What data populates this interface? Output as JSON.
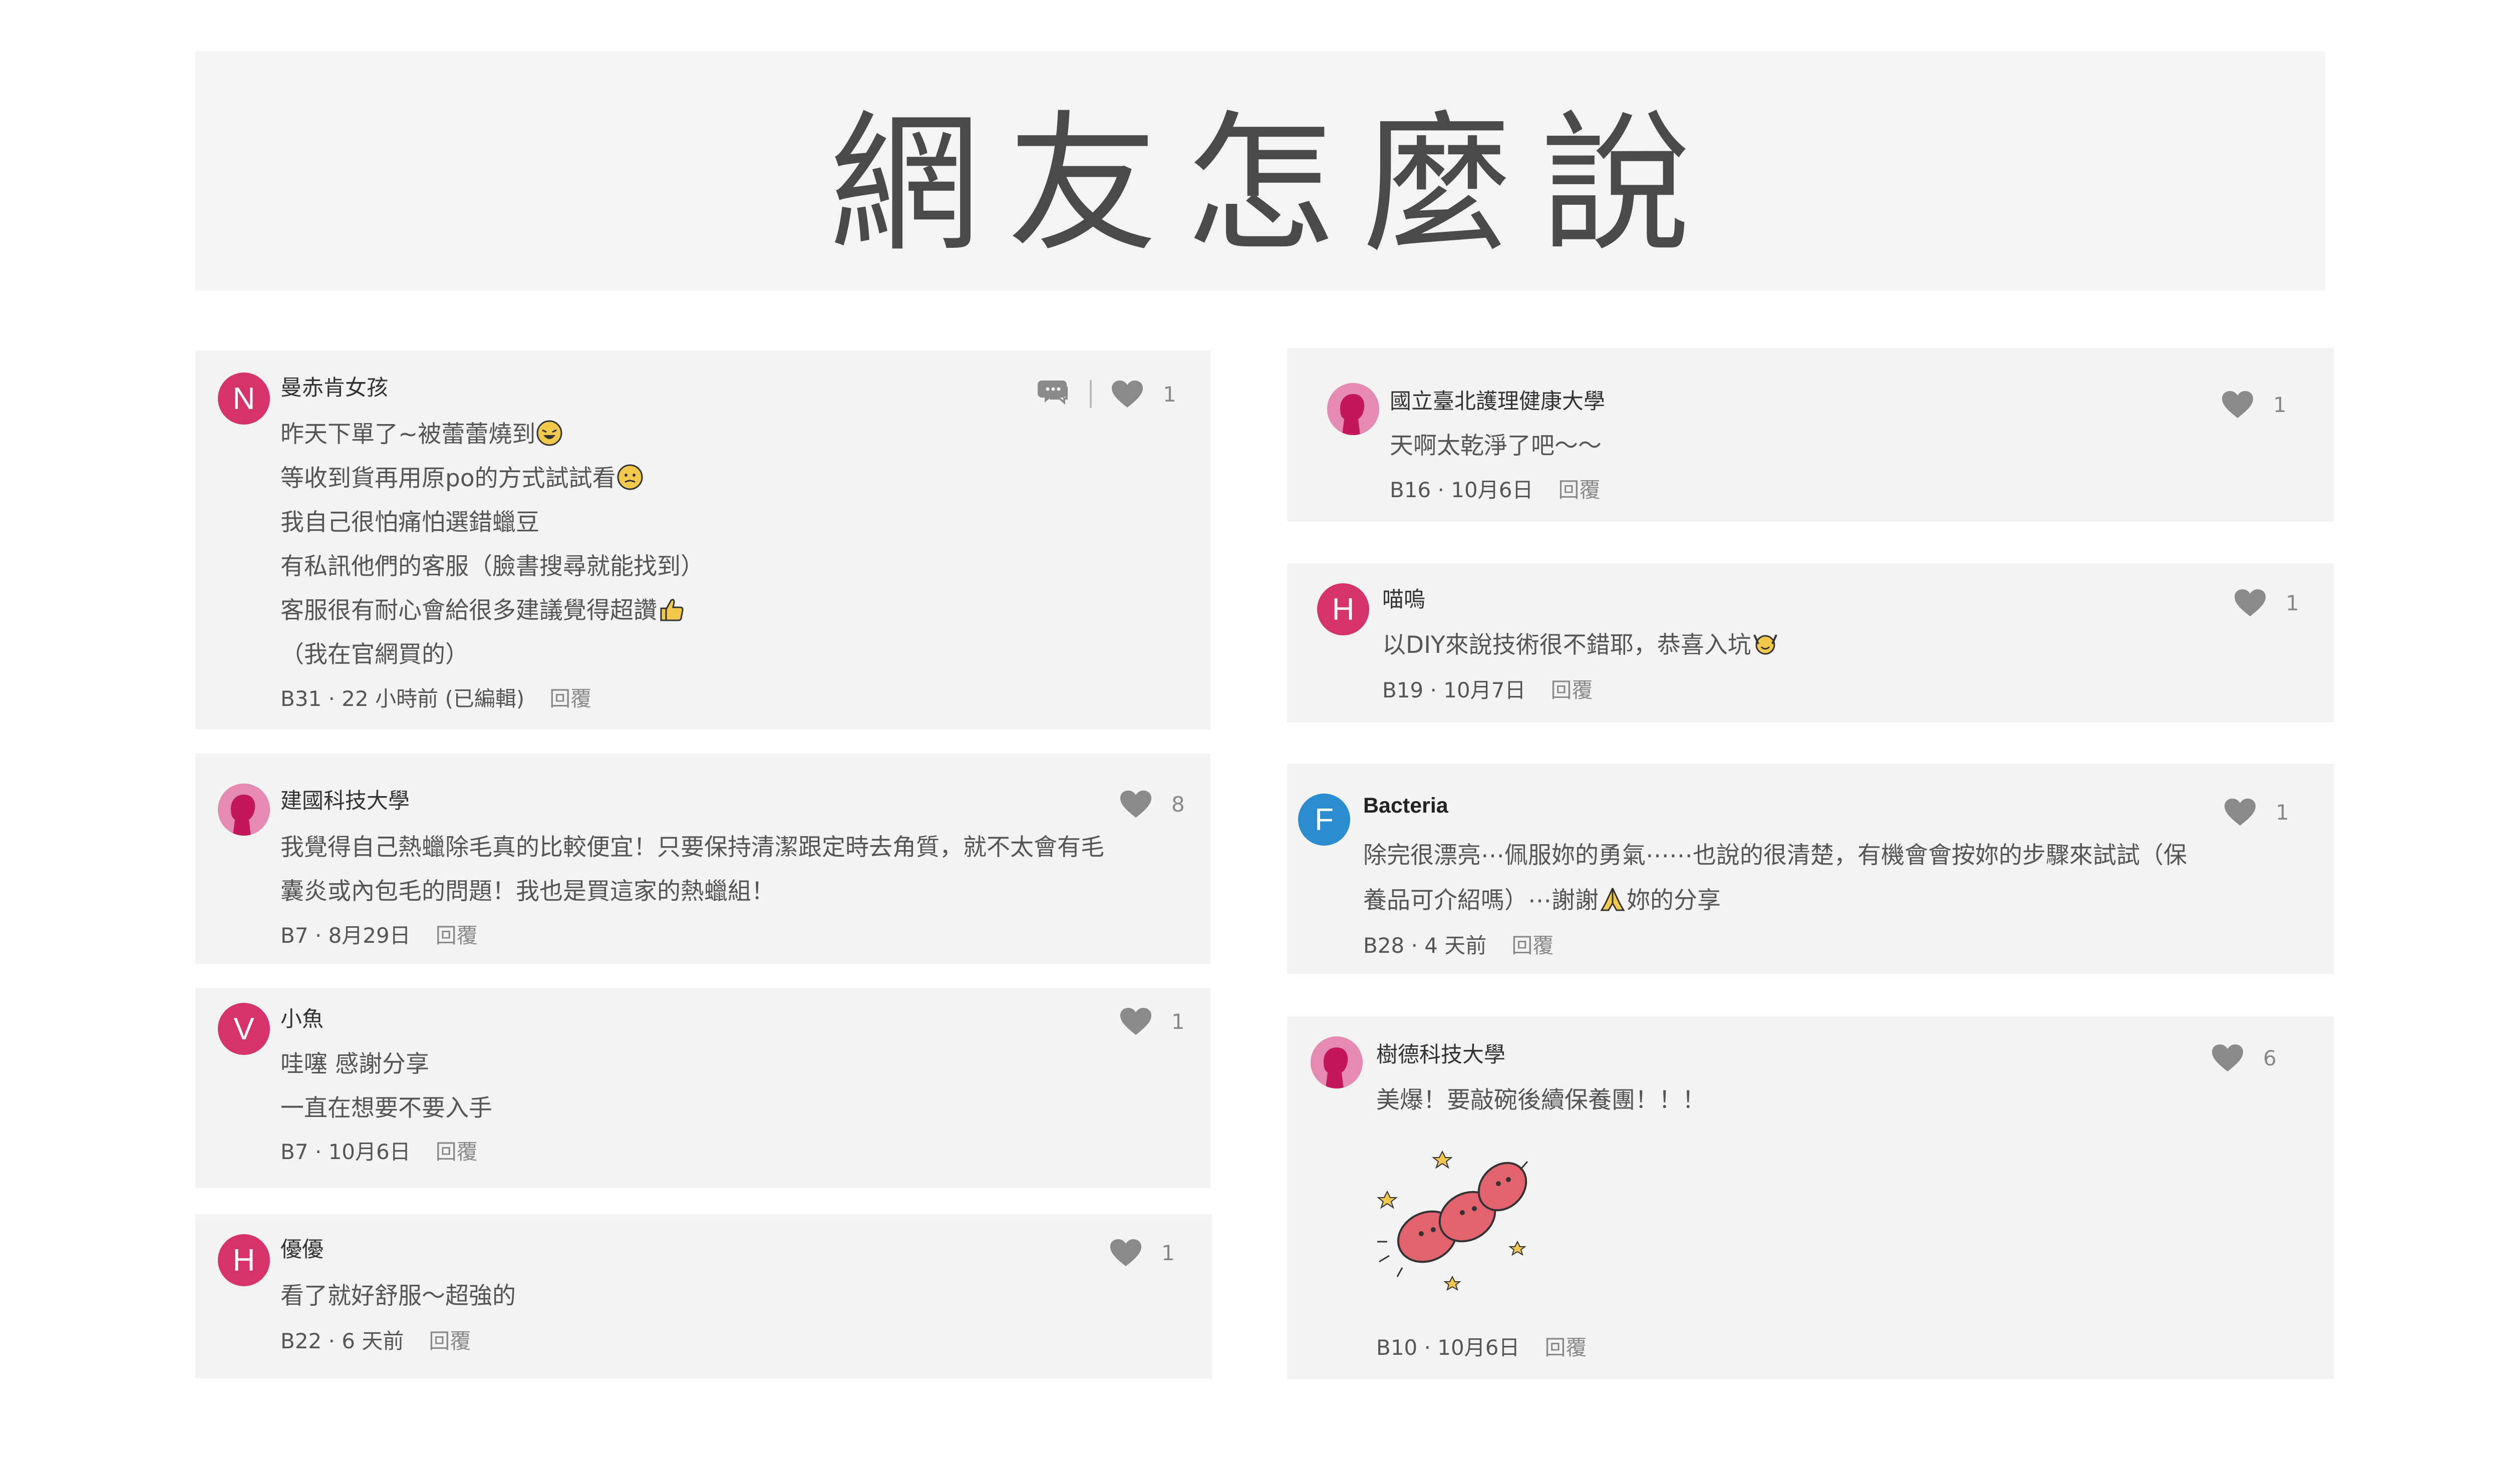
{
  "page_title": "網友怎麼說",
  "left_comments": [
    {
      "user": "曼赤肯女孩",
      "avatar_letter": "N",
      "lines": [
        "昨天下單了~被蕾蕾燒到",
        "等收到貨再用原po的方式試試看",
        "我自己很怕痛怕選錯蠟豆",
        "有私訊他們的客服（臉書搜尋就能找到）",
        "客服很有耐心會給很多建議覺得超讚",
        "（我在官網買的）"
      ],
      "meta": "B31 · 22 小時前 (已編輯)",
      "reply": "回覆",
      "likes": "1"
    },
    {
      "user": "建國科技大學",
      "lines": [
        "我覺得自己熱蠟除毛真的比較便宜！只要保持清潔跟定時去角質，就不太會有毛",
        "囊炎或內包毛的問題！我也是買這家的熱蠟組！"
      ],
      "meta": "B7 · 8月29日",
      "reply": "回覆",
      "likes": "8"
    },
    {
      "user": "小魚",
      "avatar_letter": "V",
      "lines": [
        "哇噻 感謝分享",
        "一直在想要不要入手"
      ],
      "meta": "B7 · 10月6日",
      "reply": "回覆",
      "likes": "1"
    },
    {
      "user": "優優",
      "avatar_letter": "H",
      "lines": [
        "看了就好舒服～超強的"
      ],
      "meta": "B22 · 6 天前",
      "reply": "回覆",
      "likes": "1"
    }
  ],
  "right_comments": [
    {
      "user": "國立臺北護理健康大學",
      "lines": [
        "天啊太乾淨了吧～～"
      ],
      "meta": "B16 · 10月6日",
      "reply": "回覆",
      "likes": "1"
    },
    {
      "user": "喵嗚",
      "avatar_letter": "H",
      "lines": [
        "以DIY來說技術很不錯耶，恭喜入坑"
      ],
      "meta": "B19 · 10月7日",
      "reply": "回覆",
      "likes": "1"
    },
    {
      "user": "Bacteria",
      "avatar_letter": "F",
      "lines": [
        "除完很漂亮⋯佩服妳的勇氣⋯⋯也說的很清楚，有機會會按妳的步驟來試試（保",
        "養品可介紹嗎）⋯謝謝",
        "妳的分享"
      ],
      "meta": "B28 · 4 天前",
      "reply": "回覆",
      "likes": "1"
    },
    {
      "user": "樹德科技大學",
      "lines": [
        "美爆！要敲碗後續保養團！！！"
      ],
      "meta": "B10 · 10月6日",
      "reply": "回覆",
      "likes": "6"
    }
  ],
  "icons": {
    "like": "heart-icon",
    "comment": "comment-bubble-icon",
    "school_avatar": "school-avatar-icon"
  },
  "colors": {
    "avatar_pink": "#d6336c",
    "avatar_blue": "#2b8ccf",
    "card_bg": "#f3f3f3",
    "heart": "#8a8a8a"
  }
}
